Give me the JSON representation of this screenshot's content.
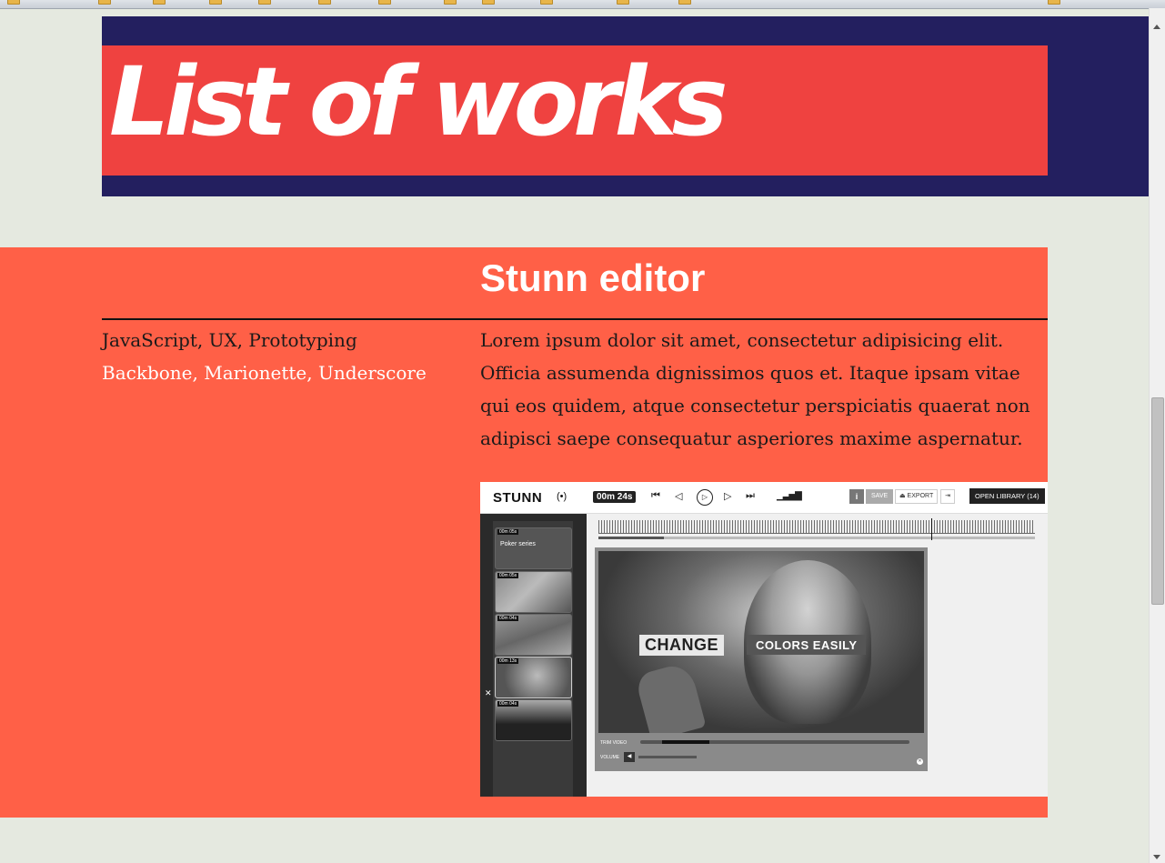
{
  "header": {
    "title": "List of works"
  },
  "project": {
    "title": "Stunn editor",
    "skills": "JavaScript, UX, Prototyping",
    "libraries": "Backbone, Marionette, Underscore",
    "description": "Lorem ipsum dolor sit amet, consectetur adipisicing elit. Officia assumenda dignissimos quos et. Itaque ipsam vitae qui eos quidem, atque consectetur perspiciatis quaerat non adipisci saepe consequatur asperiores maxime aspernatur."
  },
  "screenshot": {
    "brand": "STUNN",
    "duration": "00m 24s",
    "toolbar": {
      "info": "i",
      "save": "SAVE",
      "export": "⏏ EXPORT",
      "open_library": "OPEN LIBRARY (14)"
    },
    "clips": [
      {
        "time": "00m 05s",
        "name": "Poker series"
      },
      {
        "time": "00m 05s",
        "name": ""
      },
      {
        "time": "00m 04s",
        "name": ""
      },
      {
        "time": "00m 13s",
        "name": ""
      },
      {
        "time": "00m 04s",
        "name": ""
      }
    ],
    "captions": {
      "left": "CHANGE",
      "right": "COLORS EASILY"
    },
    "controls": {
      "trim": "TRIM VIDEO",
      "volume": "VOLUME"
    }
  },
  "colors": {
    "page_bg": "#e5e9e0",
    "navy": "#231f5f",
    "red": "#ef4240",
    "coral": "#ff6047"
  }
}
